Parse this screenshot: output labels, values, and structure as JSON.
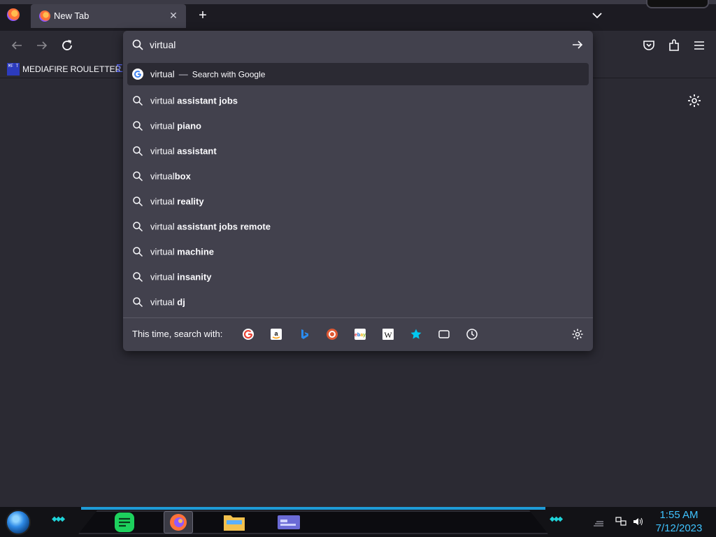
{
  "browser": {
    "tab": {
      "title": "New Tab",
      "close": "✕"
    },
    "new_tab_label": "+",
    "bookmark": {
      "label": "MEDIAFIRE ROULETTER",
      "icon_text": "MF T"
    }
  },
  "urlbar": {
    "value": "virtual",
    "placeholder": ""
  },
  "results": {
    "first": {
      "typed": "virtual",
      "separator": "—",
      "action": "Search with Google"
    },
    "suggestions": [
      {
        "prefix": "virtual ",
        "bold": "assistant jobs"
      },
      {
        "prefix": "virtual ",
        "bold": "piano"
      },
      {
        "prefix": "virtual ",
        "bold": "assistant"
      },
      {
        "prefix": "virtual",
        "bold": "box"
      },
      {
        "prefix": "virtual ",
        "bold": "reality"
      },
      {
        "prefix": "virtual ",
        "bold": "assistant jobs remote"
      },
      {
        "prefix": "virtual ",
        "bold": "machine"
      },
      {
        "prefix": "virtual ",
        "bold": "insanity"
      },
      {
        "prefix": "virtual ",
        "bold": "dj"
      }
    ]
  },
  "oneoff": {
    "label": "This time, search with:",
    "engines": [
      "google-icon",
      "amazon-icon",
      "bing-icon",
      "duckduckgo-icon",
      "ebay-icon",
      "wikipedia-icon",
      "bookmarks-star-icon",
      "tabs-icon",
      "history-icon"
    ]
  },
  "taskbar": {
    "time": "1:55 AM",
    "date": "7/12/2023"
  },
  "colors": {
    "accent_cyan": "#1fd3d8",
    "clock_blue": "#3fc3ff",
    "panel": "#42414d",
    "toolbar": "#2b2a33"
  }
}
